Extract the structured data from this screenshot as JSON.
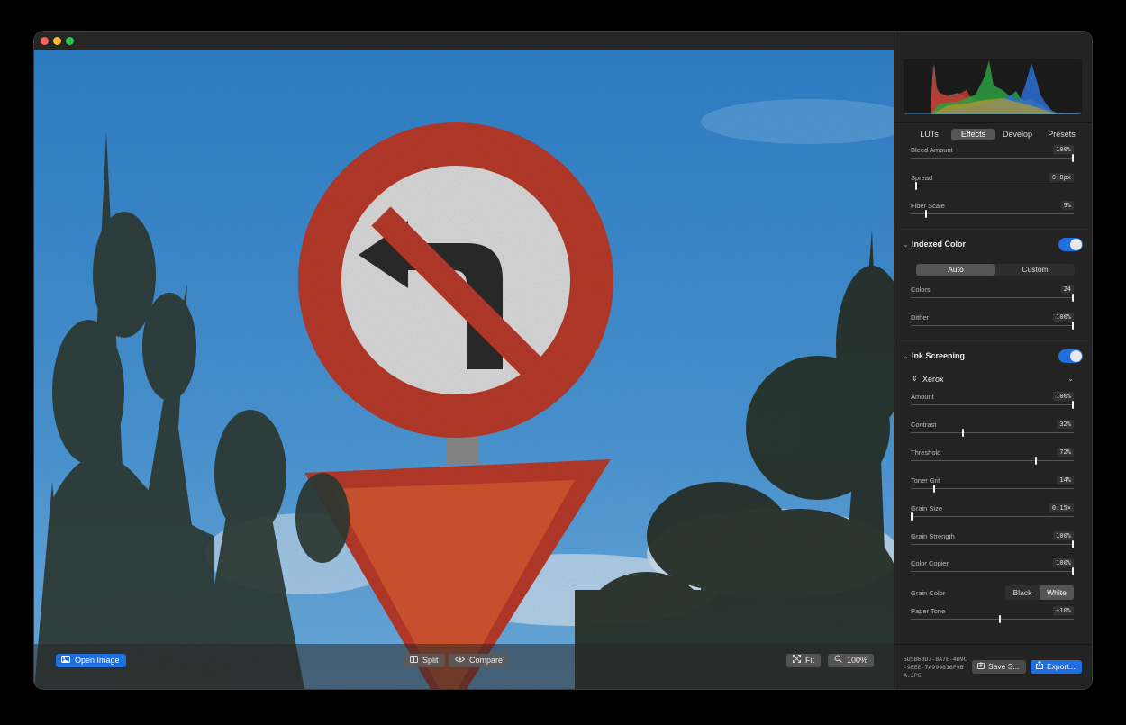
{
  "window": {
    "traffic_lights": [
      "close",
      "minimize",
      "zoom"
    ]
  },
  "toolbar": {
    "open_label": "Open Image",
    "split_label": "Split",
    "compare_label": "Compare",
    "fit_label": "Fit",
    "zoom_label": "100%"
  },
  "sidebar": {
    "tabs": [
      {
        "label": "LUTs"
      },
      {
        "label": "Effects",
        "active": true
      },
      {
        "label": "Develop"
      },
      {
        "label": "Presets"
      }
    ],
    "top_params": [
      {
        "label": "Bleed Amount",
        "value": "100%",
        "level": 1.0
      },
      {
        "label": "Spread",
        "value": "0.8px",
        "level": 0.03
      },
      {
        "label": "Fiber Scale",
        "value": "9%",
        "level": 0.09
      }
    ],
    "indexed_color": {
      "title": "Indexed Color",
      "enabled": true,
      "mode_auto": "Auto",
      "mode_custom": "Custom",
      "params": [
        {
          "label": "Colors",
          "value": "24",
          "level": 1.0
        },
        {
          "label": "Dither",
          "value": "100%",
          "level": 1.0
        }
      ]
    },
    "ink_screening": {
      "title": "Ink Screening",
      "enabled": true,
      "preset": "Xerox",
      "params": [
        {
          "label": "Amount",
          "value": "100%",
          "level": 1.0
        },
        {
          "label": "Contrast",
          "value": "32%",
          "level": 0.32
        },
        {
          "label": "Threshold",
          "value": "72%",
          "level": 0.77
        },
        {
          "label": "Toner Grit",
          "value": "14%",
          "level": 0.14
        },
        {
          "label": "Grain Size",
          "value": "0.15×",
          "level": 0.0
        },
        {
          "label": "Grain Strength",
          "value": "100%",
          "level": 1.0
        },
        {
          "label": "Color Copier",
          "value": "100%",
          "level": 1.0
        }
      ],
      "grain_color_label": "Grain Color",
      "grain_black": "Black",
      "grain_white": "White",
      "paper_tone": {
        "label": "Paper Tone",
        "value": "+10%",
        "level": 0.55
      }
    }
  },
  "footer": {
    "filename": "5D5B63D7-8A7E-4D9C-9EEE-7A999816F9BA.JPG",
    "save_label": "Save S...",
    "export_label": "Export..."
  },
  "colors": {
    "accent": "#1f6fe0",
    "sky": "#3f8fd2",
    "sign_red": "#b83a2a"
  }
}
